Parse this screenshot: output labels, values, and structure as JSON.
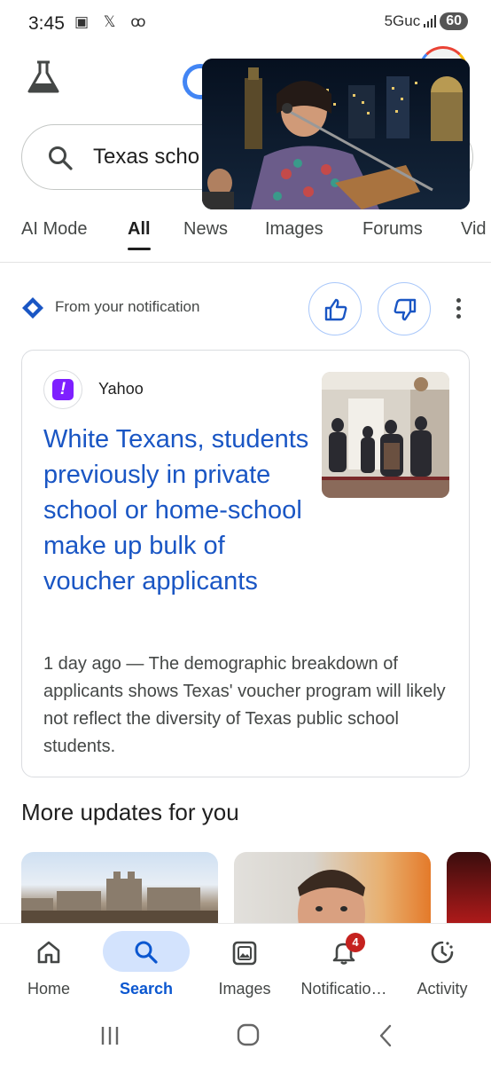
{
  "status_bar": {
    "time": "3:45",
    "left_icons": "▣ 𝕏 ꝏ",
    "network": "5Guc",
    "battery": "60"
  },
  "header": {
    "labs_icon": "flask-icon",
    "avatar_icon": "avatar"
  },
  "search": {
    "query": "Texas scho",
    "icon": "search-icon"
  },
  "pip_video": {
    "icon": "video-player"
  },
  "tabs": [
    {
      "label": "AI Mode",
      "active": false
    },
    {
      "label": "All",
      "active": true
    },
    {
      "label": "News",
      "active": false
    },
    {
      "label": "Images",
      "active": false
    },
    {
      "label": "Forums",
      "active": false
    },
    {
      "label": "Vid",
      "active": false
    }
  ],
  "notification": {
    "label": "From your notification",
    "icon": "sparkle-icon"
  },
  "article": {
    "source": "Yahoo",
    "source_logo_letter": "!",
    "title": "White Texans, students previously in private school or home-school make up bulk of voucher applicants",
    "snippet": "1 day ago — The demographic breakdown of applicants shows Texas' voucher program will likely not reflect the diversity of Texas public school students."
  },
  "more_updates": {
    "title": "More updates for you"
  },
  "bottom_nav": [
    {
      "label": "Home",
      "icon": "home-icon",
      "active": false
    },
    {
      "label": "Search",
      "icon": "search-icon",
      "active": true
    },
    {
      "label": "Images",
      "icon": "images-icon",
      "active": false
    },
    {
      "label": "Notificatio…",
      "icon": "bell-icon",
      "active": false,
      "badge": "4"
    },
    {
      "label": "Activity",
      "icon": "activity-icon",
      "active": false
    }
  ],
  "colors": {
    "link_blue": "#1a56c4",
    "active_nav": "#0b57d0",
    "pill": "#d3e3fd",
    "badge_red": "#c5221f"
  }
}
